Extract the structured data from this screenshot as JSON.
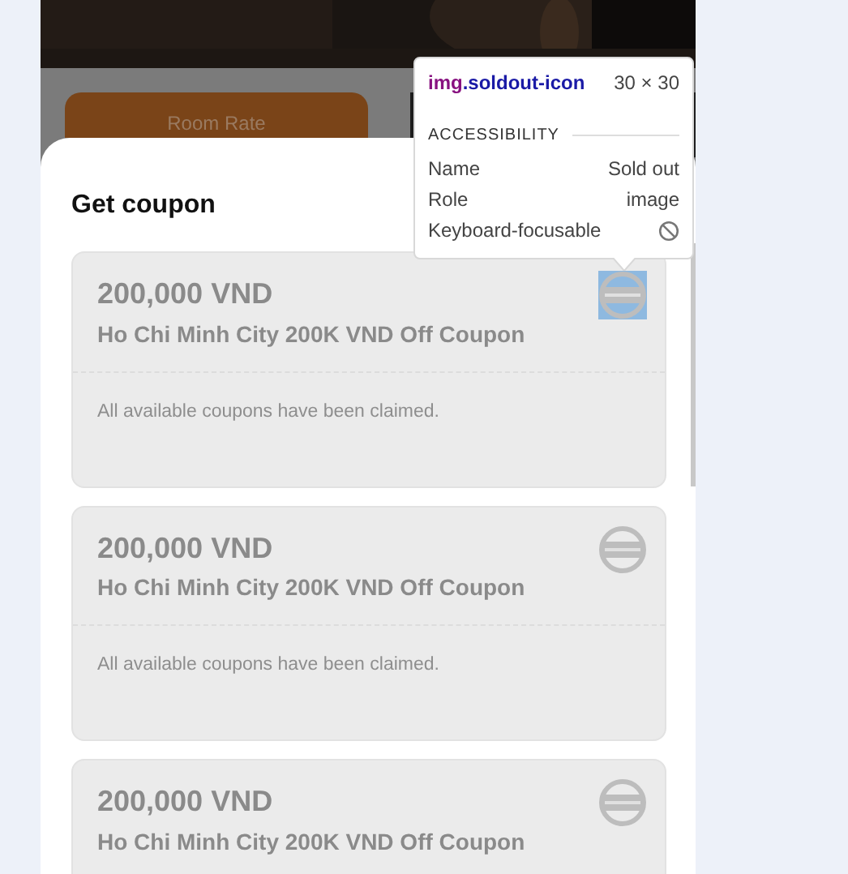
{
  "backdrop": {
    "button": "Room Rate"
  },
  "sheet": {
    "title": "Get coupon",
    "coupons": [
      {
        "amount": "200,000 VND",
        "name": "Ho Chi Minh City 200K VND Off Coupon",
        "message": "All available coupons have been claimed.",
        "sold_out": true,
        "highlighted": true
      },
      {
        "amount": "200,000 VND",
        "name": "Ho Chi Minh City 200K VND Off Coupon",
        "message": "All available coupons have been claimed.",
        "sold_out": true,
        "highlighted": false
      },
      {
        "amount": "200,000 VND",
        "name": "Ho Chi Minh City 200K VND Off Coupon",
        "sold_out": true,
        "highlighted": false
      }
    ]
  },
  "inspector_tooltip": {
    "tag": "img",
    "selector": ".soldout-icon",
    "size": "30 × 30",
    "section": "ACCESSIBILITY",
    "rows": [
      {
        "label": "Name",
        "kind": "text",
        "value": "Sold out"
      },
      {
        "label": "Role",
        "kind": "text",
        "value": "image"
      },
      {
        "label": "Keyboard-focusable",
        "kind": "flag",
        "focusable": false
      }
    ]
  }
}
